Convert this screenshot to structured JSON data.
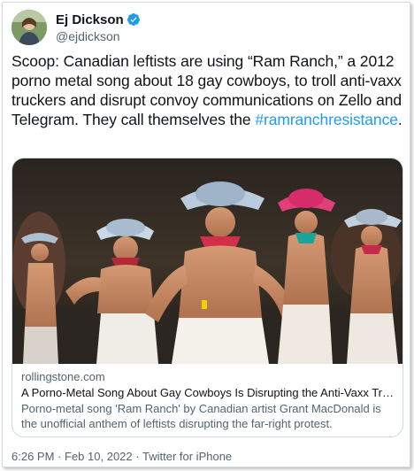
{
  "author": {
    "display_name": "Ej Dickson",
    "handle": "@ejdickson",
    "verified": true
  },
  "tweet": {
    "text": "Scoop: Canadian leftists are using “Ram Ranch,” a 2012 porno metal song about 18 gay cowboys, to troll anti-vaxx truckers and disrupt convoy communications on Zello and Telegram. They call themselves the ",
    "hashtag": "#ramranchresistance",
    "text_end": "."
  },
  "link_card": {
    "domain": "rollingstone.com",
    "title": "A Porno-Metal Song About Gay Cowboys Is Disrupting the Anti-Vaxx Trucker C...",
    "description": "Porno-metal song 'Ram Ranch' by Canadian artist Grant MacDonald is the unofficial anthem of leftists disrupting the far-right protest."
  },
  "meta": {
    "time": "6:26 PM",
    "separator": "·",
    "date": "Feb 10, 2022",
    "source": "Twitter for iPhone"
  },
  "colors": {
    "link_blue": "#1d9bf0",
    "text_primary": "#0f1419",
    "text_secondary": "#536471",
    "border": "#cfd9de"
  },
  "icons": {
    "verified": "verified-badge-icon"
  }
}
